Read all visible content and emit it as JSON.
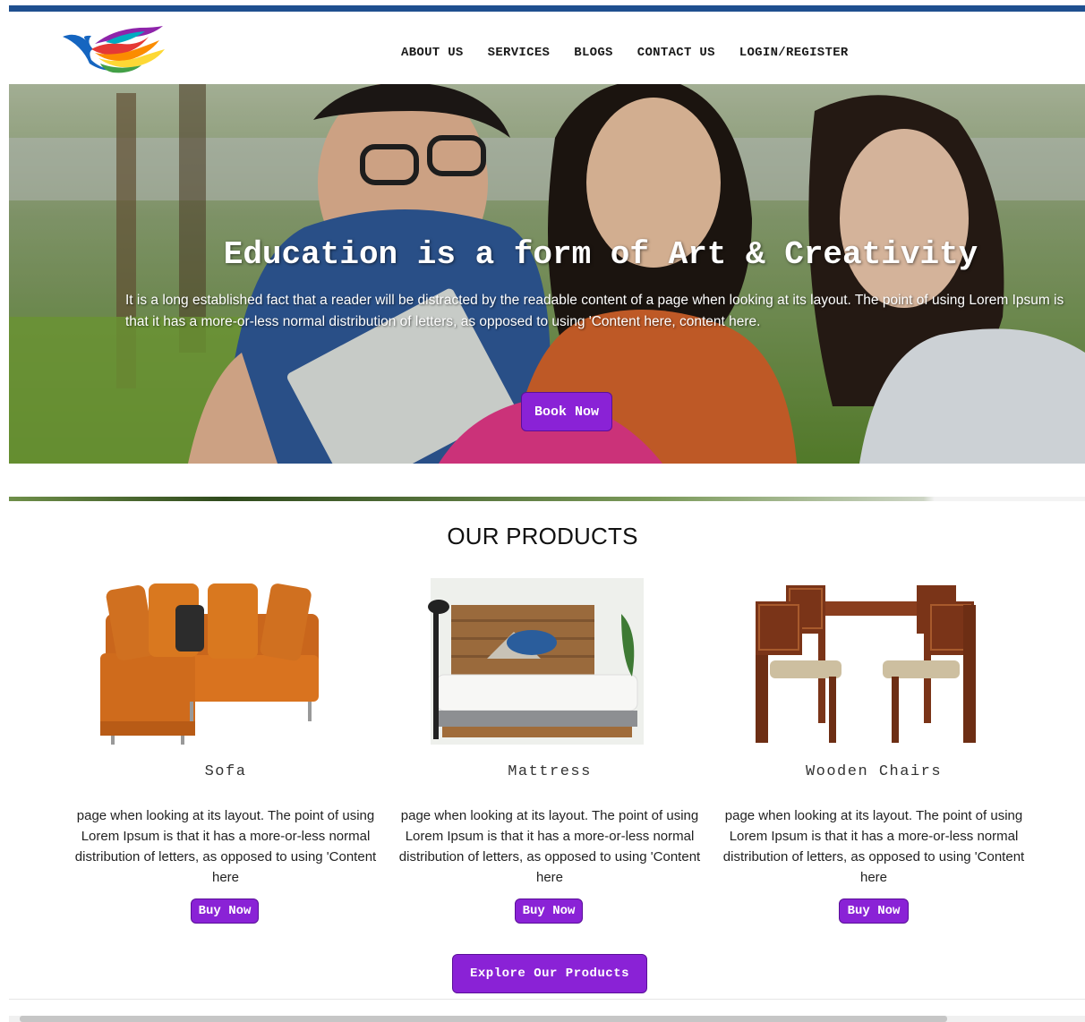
{
  "nav": {
    "items": [
      {
        "label": "ABOUT US"
      },
      {
        "label": "SERVICES"
      },
      {
        "label": "BLOGS"
      },
      {
        "label": "CONTACT US"
      },
      {
        "label": "LOGIN/REGISTER"
      }
    ]
  },
  "hero": {
    "title": "Education is a form of Art & Creativity",
    "text": "It is a long established fact that a reader will be distracted by the readable content of a page when looking at its layout. The point of using Lorem Ipsum is that it has a more-or-less normal distribution of letters, as opposed to using 'Content here, content here.",
    "button_label": "Book Now"
  },
  "products": {
    "title": "OUR PRODUCTS",
    "items": [
      {
        "name": "Sofa",
        "desc": "page when looking at its layout. The point of using Lorem Ipsum is that it has a more-or-less normal distribution of letters, as opposed to using 'Content here",
        "button_label": "Buy Now"
      },
      {
        "name": "Mattress",
        "desc": "page when looking at its layout. The point of using Lorem Ipsum is that it has a more-or-less normal distribution of letters, as opposed to using 'Content here",
        "button_label": "Buy Now"
      },
      {
        "name": "Wooden Chairs",
        "desc": "page when looking at its layout. The point of using Lorem Ipsum is that it has a more-or-less normal distribution of letters, as opposed to using 'Content here",
        "button_label": "Buy Now"
      }
    ],
    "explore_label": "Explore Our Products"
  },
  "colors": {
    "accent": "#8a22d6",
    "top_bar": "#1e4f8f"
  },
  "icons": {
    "logo": "hummingbird-logo-icon"
  }
}
